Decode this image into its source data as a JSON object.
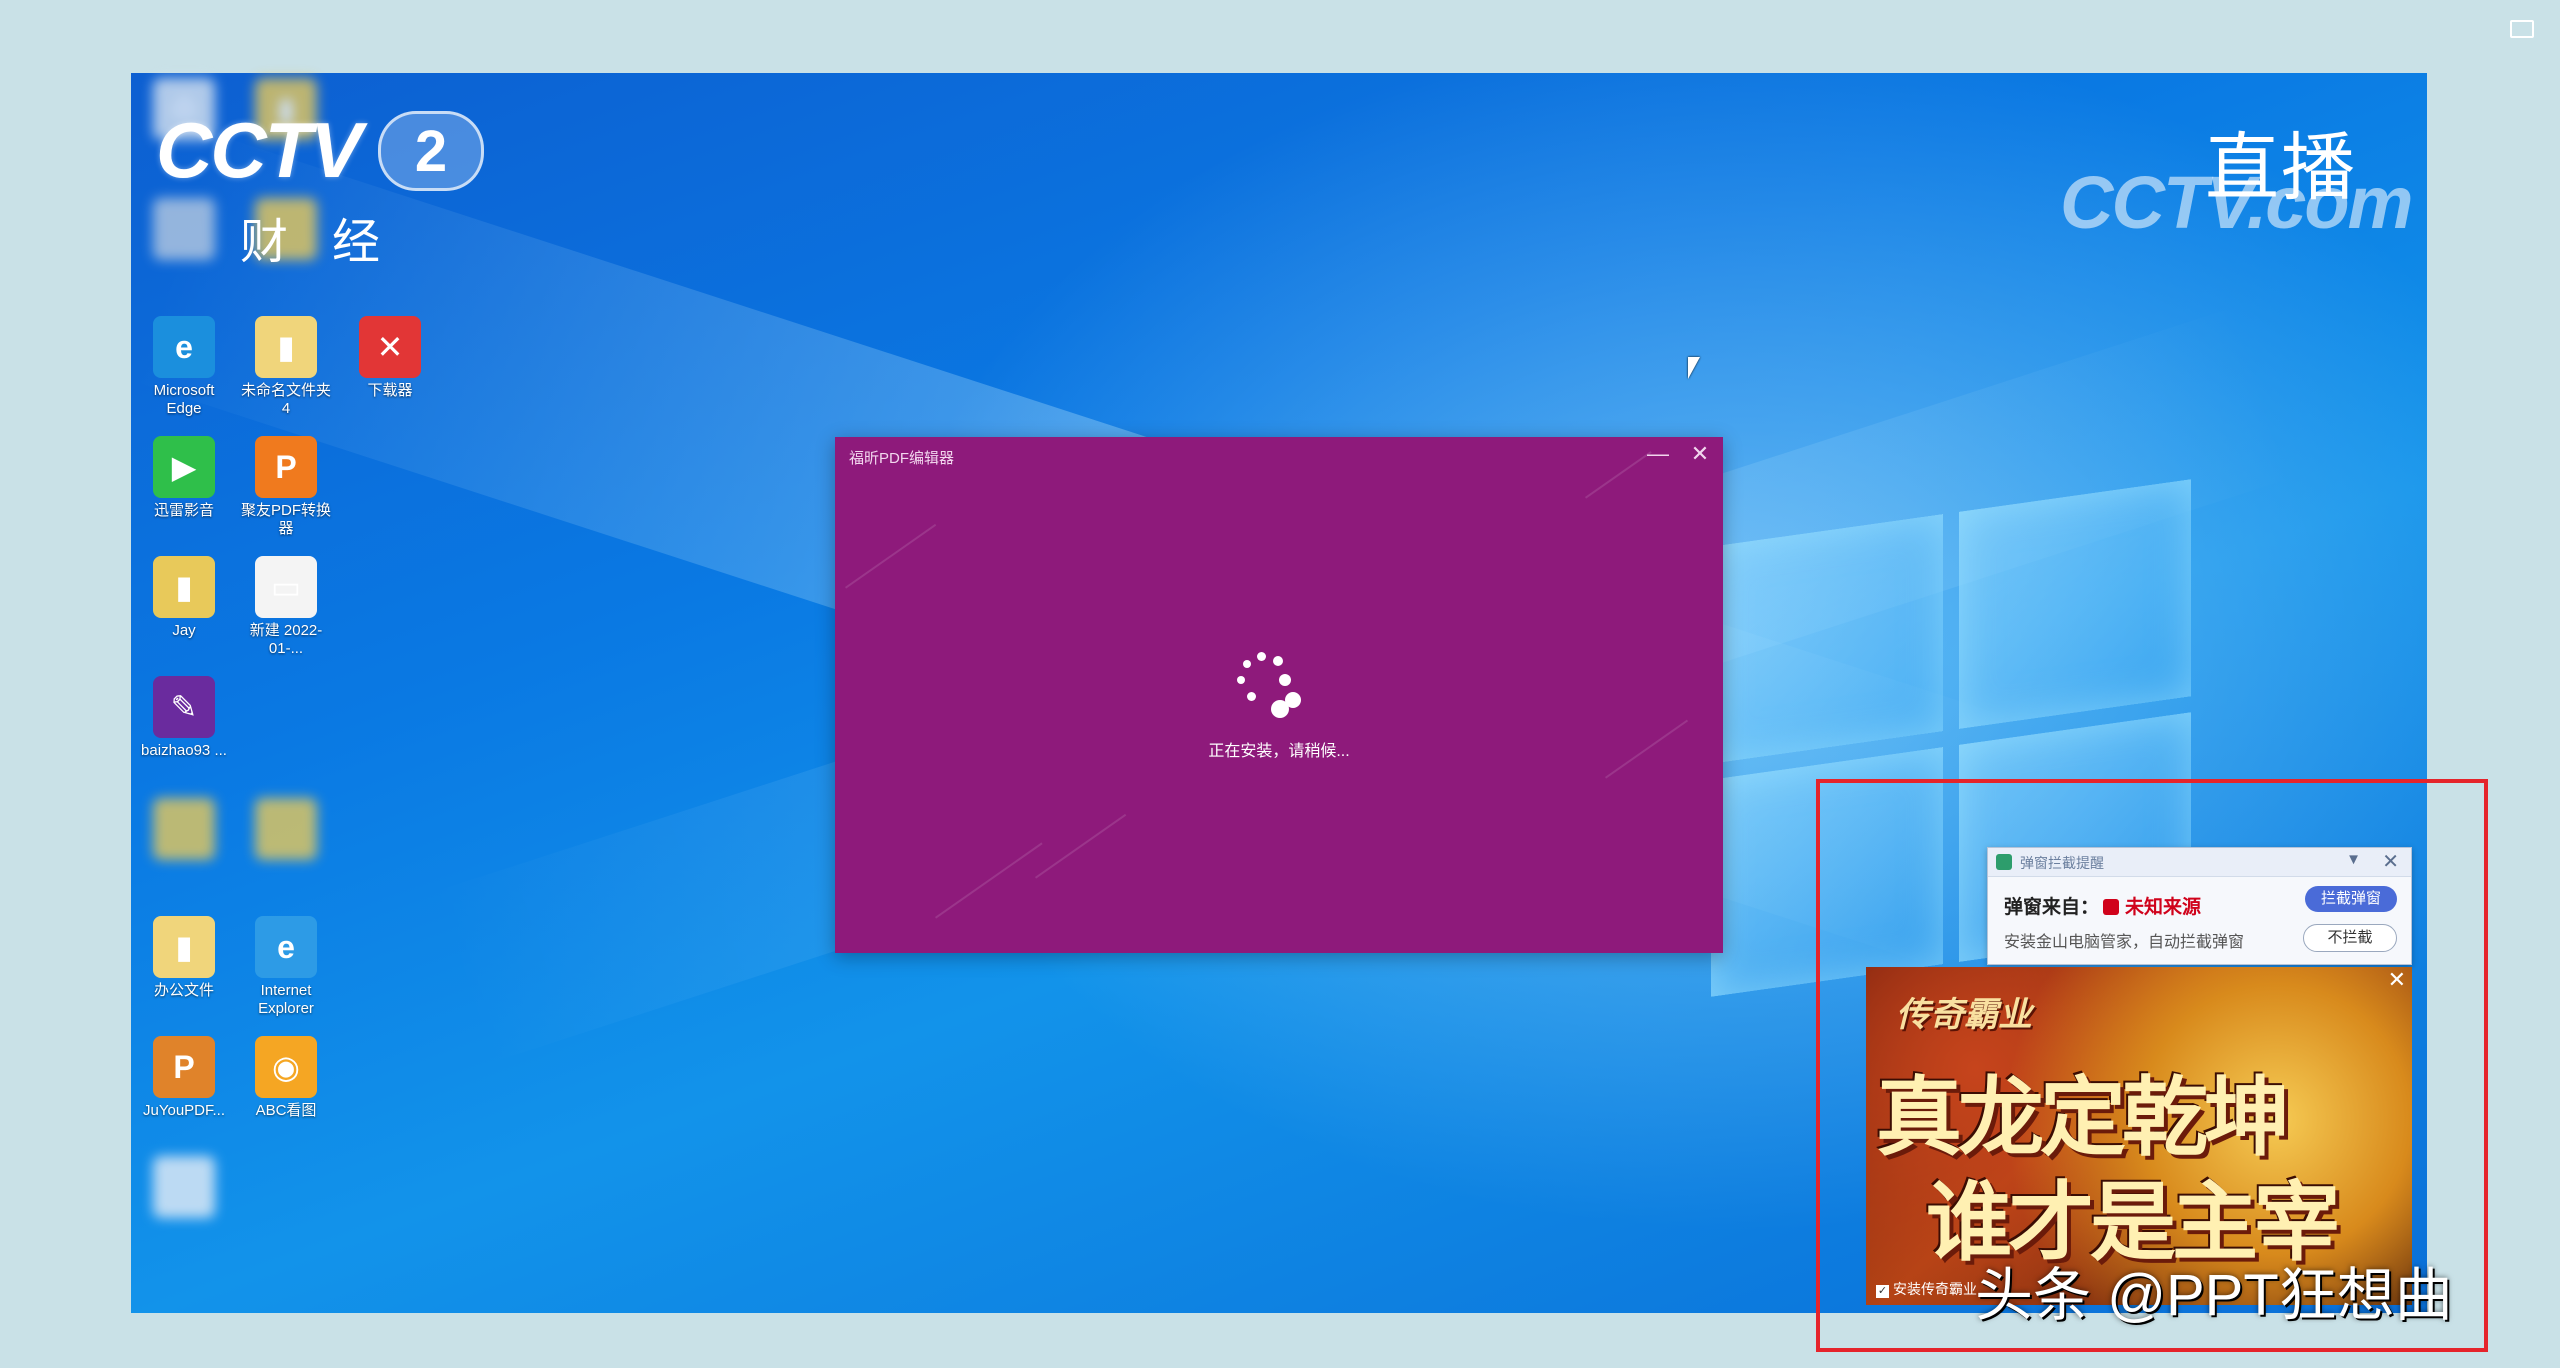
{
  "broadcast": {
    "channel_word": "CCTV",
    "channel_number": "2",
    "channel_sub": "财经",
    "live_label": "直播",
    "site_logo": "CCTV.com"
  },
  "desktop_icons": [
    {
      "label": "",
      "glyph": "♻",
      "color": "#d9e4ef",
      "blurred": true
    },
    {
      "label": "",
      "glyph": "▮",
      "color": "#e8c95a",
      "blurred": true
    },
    {
      "label": "",
      "glyph": "",
      "color": "#b6c9e0",
      "blurred": true
    },
    {
      "label": "",
      "glyph": "",
      "color": "#e8c95a",
      "blurred": true
    },
    {
      "label": "Microsoft Edge",
      "glyph": "e",
      "color": "#1b8fdd",
      "blurred": false
    },
    {
      "label": "未命名文件夹 4",
      "glyph": "▮",
      "color": "#f0d57b",
      "blurred": false
    },
    {
      "label": "下载器",
      "glyph": "✕",
      "color": "#e23636",
      "blurred": false
    },
    {
      "label": "迅雷影音",
      "glyph": "▶",
      "color": "#2fbf4a",
      "blurred": false
    },
    {
      "label": "聚友PDF转换器",
      "glyph": "P",
      "color": "#f07a1e",
      "blurred": false
    },
    {
      "label": "Jay",
      "glyph": "▮",
      "color": "#e8c95a",
      "blurred": false
    },
    {
      "label": "新建 2022-01-...",
      "glyph": "▭",
      "color": "#f4f4f4",
      "blurred": false
    },
    {
      "label": "baizhao93 ...",
      "glyph": "✎",
      "color": "#6a2b9e",
      "blurred": false
    },
    {
      "label": "",
      "glyph": "",
      "color": "#e8c95a",
      "blurred": true
    },
    {
      "label": "",
      "glyph": "",
      "color": "#e8c95a",
      "blurred": true
    },
    {
      "label": "办公文件",
      "glyph": "▮",
      "color": "#f0d57b",
      "blurred": false
    },
    {
      "label": "Internet Explorer",
      "glyph": "e",
      "color": "#2d9be6",
      "blurred": false
    },
    {
      "label": "JuYouPDF...",
      "glyph": "P",
      "color": "#e0832a",
      "blurred": false
    },
    {
      "label": "ABC看图",
      "glyph": "◉",
      "color": "#f5a623",
      "blurred": false
    },
    {
      "label": "",
      "glyph": "",
      "color": "#e8eef6",
      "blurred": true
    }
  ],
  "installer": {
    "title": "福昕PDF编辑器",
    "minimize_glyph": "—",
    "close_glyph": "✕",
    "status": "正在安装，请稍候..."
  },
  "popup": {
    "title": "弹窗拦截提醒",
    "dropdown_glyph": "▼",
    "close_glyph": "✕",
    "source_label": "弹窗来自：",
    "source_value": "未知来源",
    "description": "安装金山电脑管家，自动拦截弹窗",
    "block_button": "拦截弹窗",
    "no_block_button": "不拦截"
  },
  "ad": {
    "game_title": "传奇霸业",
    "slogan_line1": "真龙定乾坤",
    "slogan_line2": "谁才是主宰",
    "close_glyph": "✕",
    "checkbox_label": "安装传奇霸业",
    "checkbox_checked": true
  },
  "watermark": "头条 @PPT狂想曲",
  "colors": {
    "installer_bg": "#8e1a7b",
    "highlight_border": "#e5242b",
    "popup_button": "#4a6bd8"
  }
}
